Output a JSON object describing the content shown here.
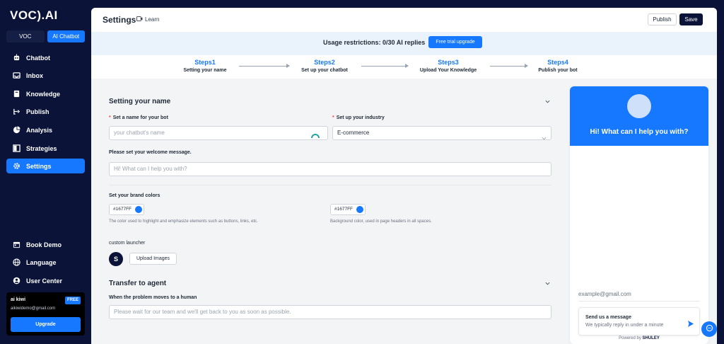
{
  "sidebar": {
    "logo": "VOC).AI",
    "toggle": {
      "voc": "VOC",
      "ai": "AI Chatbot"
    },
    "items": [
      {
        "label": "Chatbot",
        "icon": "robot-icon"
      },
      {
        "label": "Inbox",
        "icon": "inbox-icon"
      },
      {
        "label": "Knowledge",
        "icon": "book-icon"
      },
      {
        "label": "Publish",
        "icon": "publish-icon"
      },
      {
        "label": "Analysis",
        "icon": "pie-chart-icon"
      },
      {
        "label": "Strategies",
        "icon": "layout-icon"
      },
      {
        "label": "Settings",
        "icon": "gear-icon",
        "active": true
      }
    ],
    "bottom_items": [
      {
        "label": "Book Demo",
        "icon": "calendar-icon"
      },
      {
        "label": "Language",
        "icon": "globe-icon"
      },
      {
        "label": "User Center",
        "icon": "user-icon"
      }
    ],
    "user": {
      "name": "ai kiwi",
      "email": "aikiwidemo@gmail.com",
      "badge": "FREE",
      "upgrade_label": "Upgrade"
    }
  },
  "header": {
    "title": "Settings",
    "learn_label": "Learn",
    "publish_label": "Publish",
    "save_label": "Save"
  },
  "usage": {
    "text": "Usage restrictions: 0/30 AI replies",
    "button": "Free trial upgrade"
  },
  "steps": [
    {
      "num": "Steps1",
      "title": "Setting your name"
    },
    {
      "num": "Steps2",
      "title": "Set up your chatbot"
    },
    {
      "num": "Steps3",
      "title": "Upload Your Knowledge"
    },
    {
      "num": "Steps4",
      "title": "Publish your bot"
    }
  ],
  "name_section": {
    "title": "Setting your name",
    "bot_name_label": "Set a name for your bot",
    "bot_name_placeholder": "your chatbot's name",
    "industry_label": "Set up your industry",
    "industry_value": "E-commerce",
    "welcome_label": "Please set your welcome message.",
    "welcome_placeholder": "Hi! What can I help you with?",
    "brand_colors_label": "Set your brand colors",
    "primary_color": "#1677FF",
    "primary_hint": "The color used to highlight and emphasize elements such as buttons, links, etc.",
    "header_color": "#1677FF",
    "header_hint": "Background color, used in page headers in all spaces.",
    "launcher_label": "custom launcher",
    "launcher_letter": "S",
    "upload_label": "Upload Images"
  },
  "transfer_section": {
    "title": "Transfer to agent",
    "label": "When the problem moves to a human",
    "placeholder": "Please wait for our team and we'll get back to you as soon as possible."
  },
  "preview": {
    "greeting": "Hi! What can I help you with?",
    "email_placeholder": "example@gmail.com",
    "send_title": "Send us a message",
    "send_sub": "We typically reply in under a minute",
    "powered_by": "Powered by",
    "powered_brand": "SHULEY"
  },
  "colors": {
    "accent": "#1677ff",
    "sidebar_bg": "#0b1438"
  }
}
